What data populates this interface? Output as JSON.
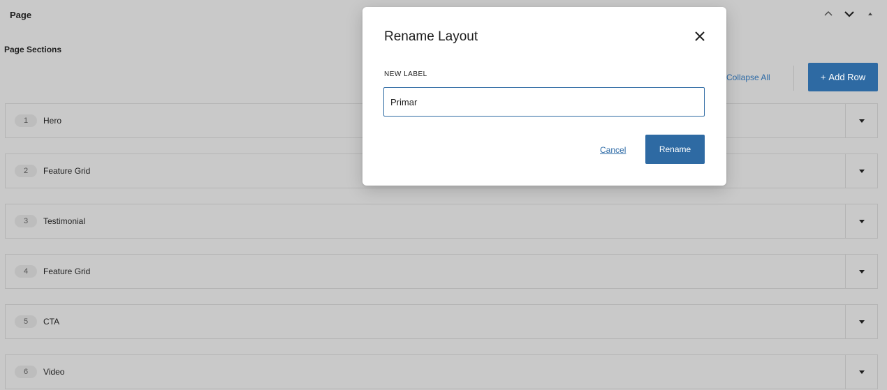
{
  "page": {
    "title": "Page",
    "sections_label": "Page Sections"
  },
  "toolbar": {
    "collapse_all_label": "Collapse All",
    "add_row_label": "Add Row",
    "add_row_icon": "+"
  },
  "rows": [
    {
      "number": "1",
      "label": "Hero"
    },
    {
      "number": "2",
      "label": "Feature Grid"
    },
    {
      "number": "3",
      "label": "Testimonial"
    },
    {
      "number": "4",
      "label": "Feature Grid"
    },
    {
      "number": "5",
      "label": "CTA"
    },
    {
      "number": "6",
      "label": "Video"
    }
  ],
  "modal": {
    "title": "Rename Layout",
    "field_label": "New Label",
    "field_value": "Primar",
    "cancel_label": "Cancel",
    "rename_label": "Rename"
  },
  "colors": {
    "accent": "#2e6aa3",
    "link": "#2c6aa6",
    "overlay_bg": "#c9c9c9"
  }
}
